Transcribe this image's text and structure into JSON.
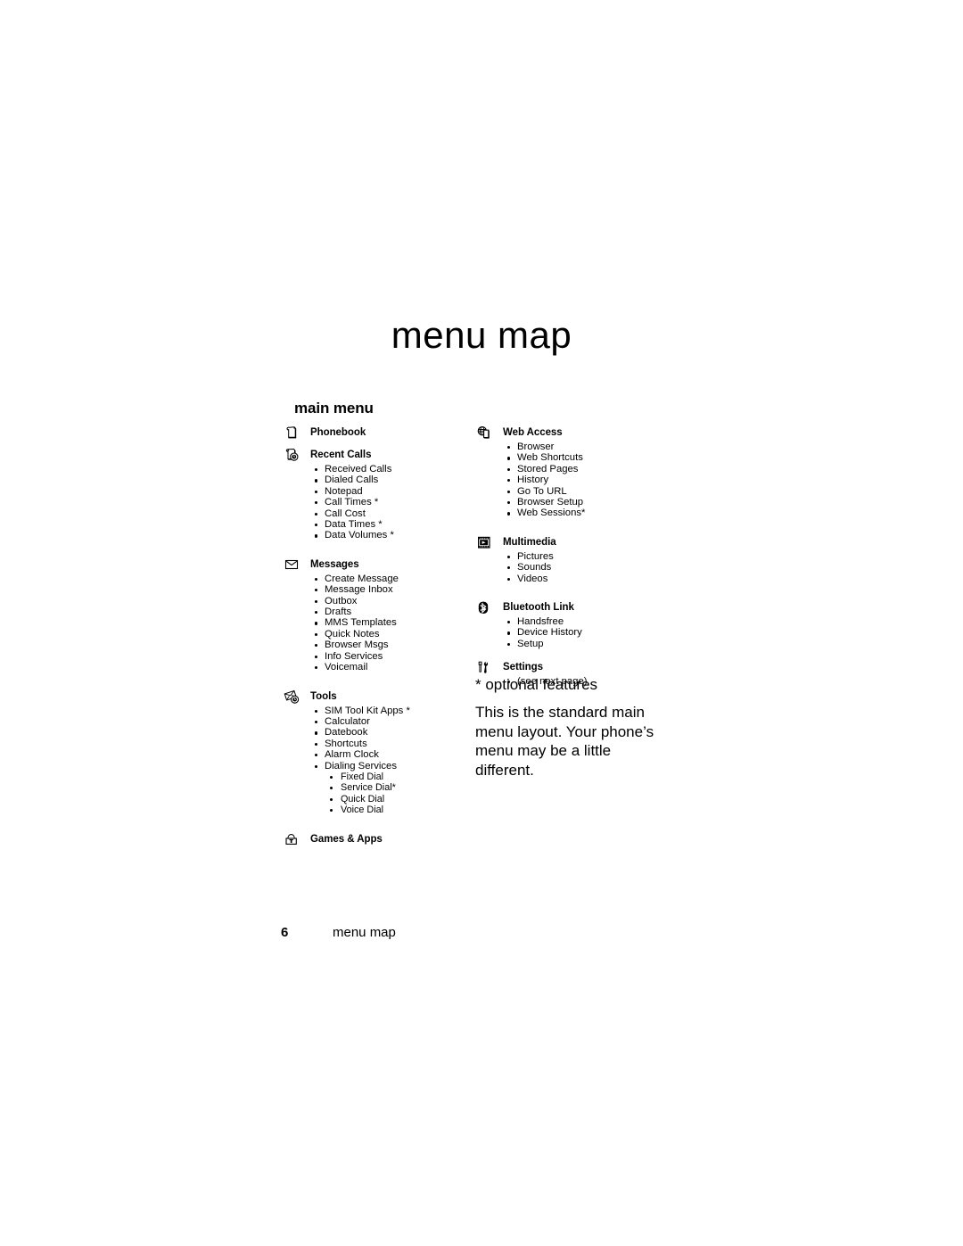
{
  "document": {
    "title": "menu map",
    "section_heading": "main menu"
  },
  "footer": {
    "page_number": "6",
    "label": "menu map"
  },
  "notes": {
    "optional_legend": "* optional features",
    "body": "This is the standard main menu layout. Your phone’s menu may be a little different."
  },
  "columns": {
    "left": [
      {
        "icon": "phonebook-icon",
        "title": "Phonebook",
        "items": []
      },
      {
        "icon": "recent-calls-icon",
        "title": "Recent Calls",
        "items": [
          "Received Calls",
          "Dialed Calls",
          "Notepad",
          "Call Times *",
          "Call Cost",
          "Data Times *",
          "Data Volumes *"
        ]
      },
      {
        "icon": "messages-icon",
        "title": "Messages",
        "items": [
          "Create Message",
          "Message Inbox",
          "Outbox",
          "Drafts",
          "MMS Templates",
          "Quick Notes",
          "Browser Msgs",
          "Info Services",
          "Voicemail"
        ]
      },
      {
        "icon": "tools-icon",
        "title": "Tools",
        "items": [
          "SIM Tool Kit Apps *",
          "Calculator",
          "Datebook",
          "Shortcuts",
          "Alarm Clock",
          "Dialing Services"
        ],
        "subitems": [
          "Fixed Dial",
          "Service Dial*",
          "Quick Dial",
          "Voice Dial"
        ]
      },
      {
        "icon": "games-apps-icon",
        "title": "Games & Apps",
        "items": []
      }
    ],
    "right": [
      {
        "icon": "web-access-icon",
        "title": "Web Access",
        "items": [
          "Browser",
          "Web Shortcuts",
          "Stored Pages",
          "History",
          "Go To URL",
          "Browser Setup",
          "Web Sessions*"
        ]
      },
      {
        "icon": "multimedia-icon",
        "title": "Multimedia",
        "items": [
          "Pictures",
          "Sounds",
          "Videos"
        ]
      },
      {
        "icon": "bluetooth-icon",
        "title": "Bluetooth Link",
        "items": [
          "Handsfree",
          "Device History",
          "Setup"
        ]
      },
      {
        "icon": "settings-icon",
        "title": "Settings",
        "items": [
          "(see next page)"
        ]
      }
    ]
  },
  "colors": {
    "text": "#000000",
    "background": "#ffffff"
  }
}
